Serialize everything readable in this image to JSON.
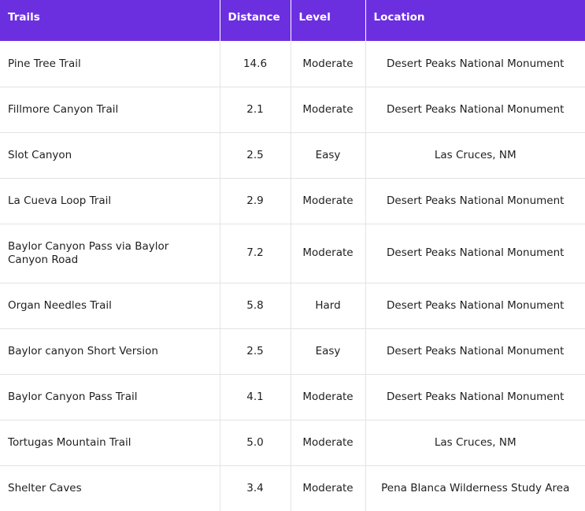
{
  "colors": {
    "header_bg": "#6b2fe0",
    "header_text": "#ffffff",
    "grid_line": "#e3e3e3"
  },
  "table": {
    "headers": {
      "trails": "Trails",
      "distance": "Distance",
      "level": "Level",
      "location": "Location"
    },
    "rows": [
      {
        "trail": "Pine Tree Trail",
        "distance": "14.6",
        "level": "Moderate",
        "location": "Desert Peaks National Monument"
      },
      {
        "trail": "Fillmore Canyon Trail",
        "distance": "2.1",
        "level": "Moderate",
        "location": "Desert Peaks National Monument"
      },
      {
        "trail": "Slot Canyon",
        "distance": "2.5",
        "level": "Easy",
        "location": "Las Cruces, NM"
      },
      {
        "trail": "La Cueva Loop Trail",
        "distance": "2.9",
        "level": "Moderate",
        "location": "Desert Peaks National Monument"
      },
      {
        "trail": "Baylor Canyon Pass via Baylor Canyon Road",
        "distance": "7.2",
        "level": "Moderate",
        "location": "Desert Peaks National Monument"
      },
      {
        "trail": "Organ Needles Trail",
        "distance": "5.8",
        "level": "Hard",
        "location": "Desert Peaks National Monument"
      },
      {
        "trail": "Baylor canyon Short Version",
        "distance": "2.5",
        "level": "Easy",
        "location": "Desert Peaks National Monument"
      },
      {
        "trail": "Baylor Canyon Pass Trail",
        "distance": "4.1",
        "level": "Moderate",
        "location": "Desert Peaks National Monument"
      },
      {
        "trail": "Tortugas Mountain Trail",
        "distance": "5.0",
        "level": "Moderate",
        "location": "Las Cruces, NM"
      },
      {
        "trail": "Shelter Caves",
        "distance": "3.4",
        "level": "Moderate",
        "location": "Pena Blanca Wilderness Study Area"
      }
    ]
  }
}
